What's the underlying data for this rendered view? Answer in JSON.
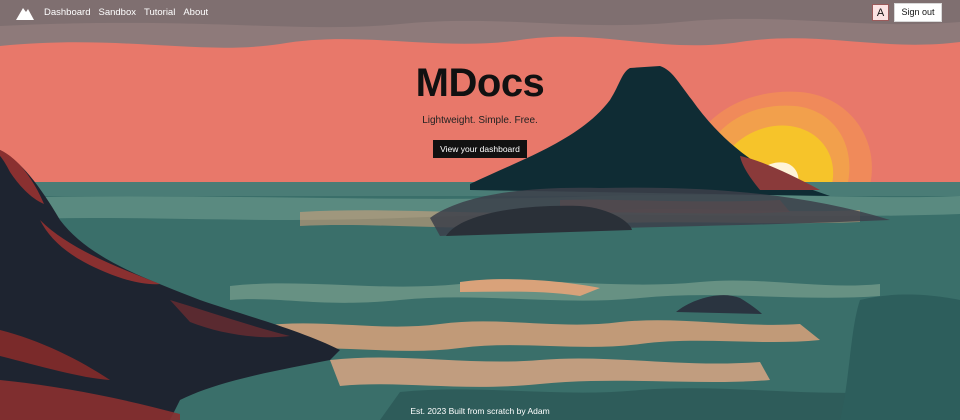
{
  "nav": {
    "logo_icon": "mountain-logo-icon",
    "links": [
      {
        "label": "Dashboard"
      },
      {
        "label": "Sandbox"
      },
      {
        "label": "Tutorial"
      },
      {
        "label": "About"
      }
    ],
    "avatar_letter": "A",
    "signout_label": "Sign out"
  },
  "hero": {
    "title": "MDocs",
    "subtitle": "Lightweight. Simple. Free.",
    "cta_label": "View your dashboard"
  },
  "footer": {
    "text": "Est. 2023 Built from scratch by Adam"
  },
  "colors": {
    "sky": "#e8786a",
    "sea": "#3a6f6a",
    "sun_outer": "#f0a05a",
    "sun_inner": "#f6c42a",
    "volcano": "#0f2c34",
    "cliffs": "#1e2430",
    "cliff_red": "#8a3030",
    "foam": "#d9a27a",
    "nav_band": "#8e7a7a",
    "cta_bg": "#111111"
  }
}
